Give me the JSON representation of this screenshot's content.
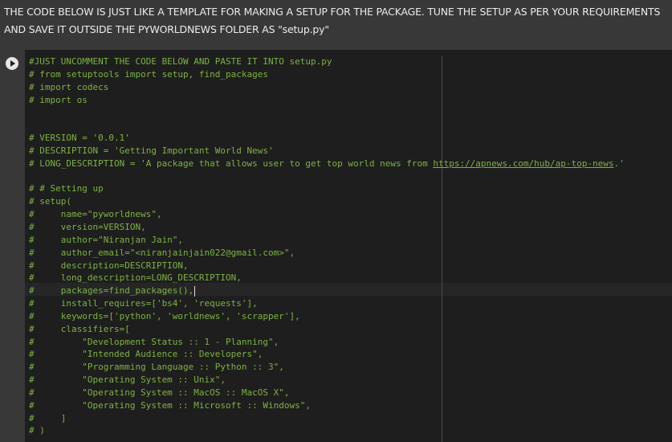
{
  "markdown": {
    "text": "THE CODE BELOW IS JUST LIKE A TEMPLATE FOR MAKING A SETUP FOR THE PACKAGE. TUNE THE SETUP AS PER YOUR REQUIREMENTS AND SAVE IT OUTSIDE THE PYWORLDNEWS FOLDER AS \"setup.py\""
  },
  "cell": {
    "run_icon": "play-icon",
    "lines": [
      "#JUST UNCOMMENT THE CODE BELOW AND PASTE IT INTO setup.py",
      "# from setuptools import setup, find_packages",
      "# import codecs",
      "# import os",
      "",
      "",
      "# VERSION = '0.0.1'",
      "# DESCRIPTION = 'Getting Important World News'",
      "# LONG_DESCRIPTION = 'A package that allows user to get top world news from ",
      "",
      "# # Setting up",
      "# setup(",
      "#     name=\"pyworldnews\",",
      "#     version=VERSION,",
      "#     author=\"Niranjan Jain\",",
      "#     author_email=\"<niranjainjain022@gmail.com>\",",
      "#     description=DESCRIPTION,",
      "#     long_description=LONG_DESCRIPTION,",
      "#     packages=find_packages(),",
      "#     install_requires=['bs4', 'requests'],",
      "#     keywords=['python', 'worldnews', 'scrapper'],",
      "#     classifiers=[",
      "#         \"Development Status :: 1 - Planning\",",
      "#         \"Intended Audience :: Developers\",",
      "#         \"Programming Language :: Python :: 3\",",
      "#         \"Operating System :: Unix\",",
      "#         \"Operating System :: MacOS :: MacOS X\",",
      "#         \"Operating System :: Microsoft :: Windows\",",
      "#     ]",
      "# )"
    ],
    "link_line": {
      "url": "https://apnews.com/hub/ap-top-news",
      "suffix": ".'"
    }
  },
  "colors": {
    "comment": "#7cb342",
    "background": "#1e1e1e",
    "gutter": "#383838"
  }
}
